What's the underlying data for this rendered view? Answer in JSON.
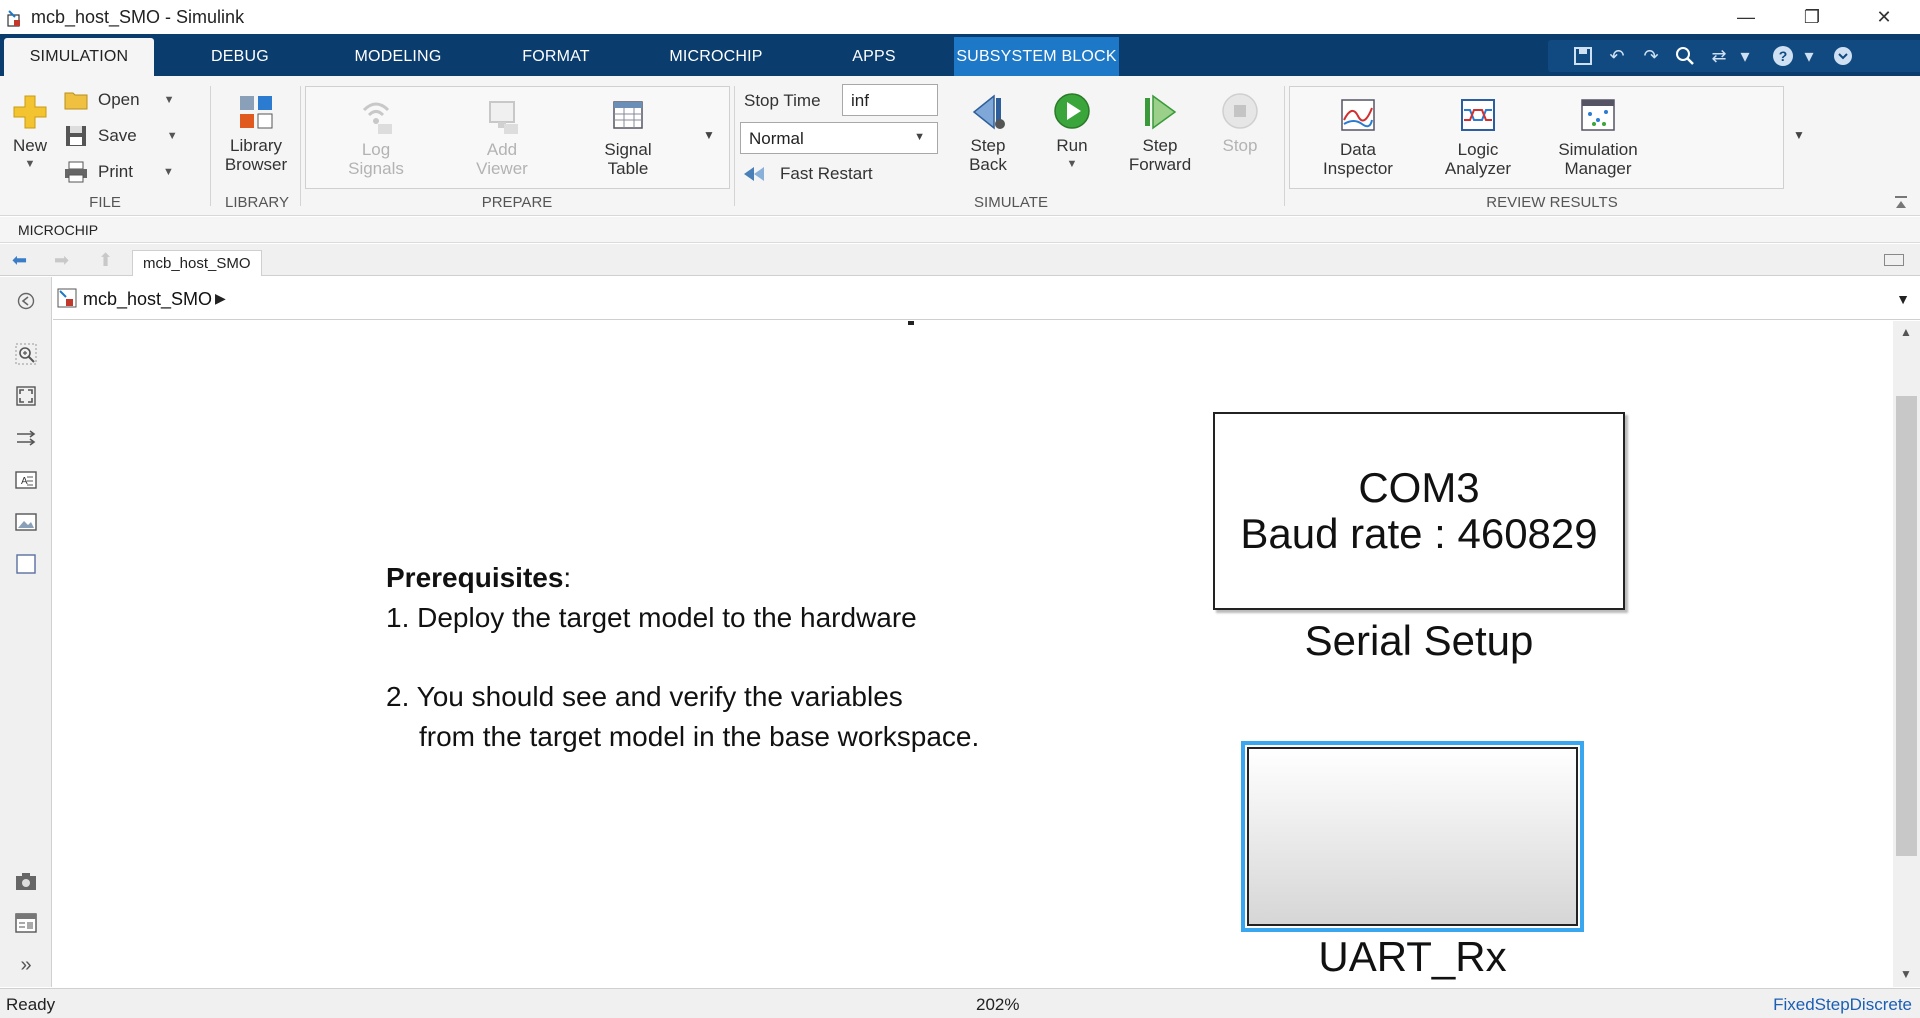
{
  "window": {
    "title": "mcb_host_SMO - Simulink",
    "minimize": "—",
    "restore": "❐",
    "close": "✕"
  },
  "tabs": [
    {
      "label": "SIMULATION",
      "active": true
    },
    {
      "label": "DEBUG"
    },
    {
      "label": "MODELING"
    },
    {
      "label": "FORMAT"
    },
    {
      "label": "MICROCHIP"
    },
    {
      "label": "APPS"
    },
    {
      "label": "SUBSYSTEM BLOCK",
      "contextual": true
    }
  ],
  "ribbon": {
    "file": {
      "new_label": "New",
      "open_label": "Open",
      "save_label": "Save",
      "print_label": "Print",
      "section": "FILE"
    },
    "library": {
      "browser_line1": "Library",
      "browser_line2": "Browser",
      "section": "LIBRARY"
    },
    "prepare": {
      "log_line1": "Log",
      "log_line2": "Signals",
      "viewer_line1": "Add",
      "viewer_line2": "Viewer",
      "table_line1": "Signal",
      "table_line2": "Table",
      "section": "PREPARE"
    },
    "simulate": {
      "stop_time_label": "Stop Time",
      "stop_time_value": "inf",
      "mode_value": "Normal",
      "fast_restart_label": "Fast Restart",
      "step_back_line1": "Step",
      "step_back_line2": "Back",
      "run_label": "Run",
      "step_fwd_line1": "Step",
      "step_fwd_line2": "Forward",
      "stop_label": "Stop",
      "section": "SIMULATE"
    },
    "review": {
      "data_line1": "Data",
      "data_line2": "Inspector",
      "logic_line1": "Logic",
      "logic_line2": "Analyzer",
      "sim_line1": "Simulation",
      "sim_line2": "Manager",
      "section": "REVIEW RESULTS"
    }
  },
  "microchip_bar": {
    "label": "MICROCHIP"
  },
  "nav": {
    "model_tab": "mcb_host_SMO"
  },
  "address": {
    "crumb": "mcb_host_SMO"
  },
  "canvas": {
    "prereq_title": "Prerequisites",
    "prereq_colon": ":",
    "step1": "1. Deploy the target model to the hardware",
    "step2_line1": "2. You should see and verify the variables",
    "step2_line2": "from the target model in the base workspace.",
    "serial_block": {
      "line1": "COM3",
      "line2": "Baud rate : 460829",
      "name": "Serial Setup"
    },
    "uart_block": {
      "name": "UART_Rx"
    }
  },
  "status": {
    "left": "Ready",
    "zoom": "202%",
    "solver": "FixedStepDiscrete"
  },
  "colors": {
    "tab_bar": "#0a3d6e",
    "contextual_tab": "#1e78c8",
    "selection": "#3aa6f0",
    "solver_link": "#1a5fb4"
  }
}
